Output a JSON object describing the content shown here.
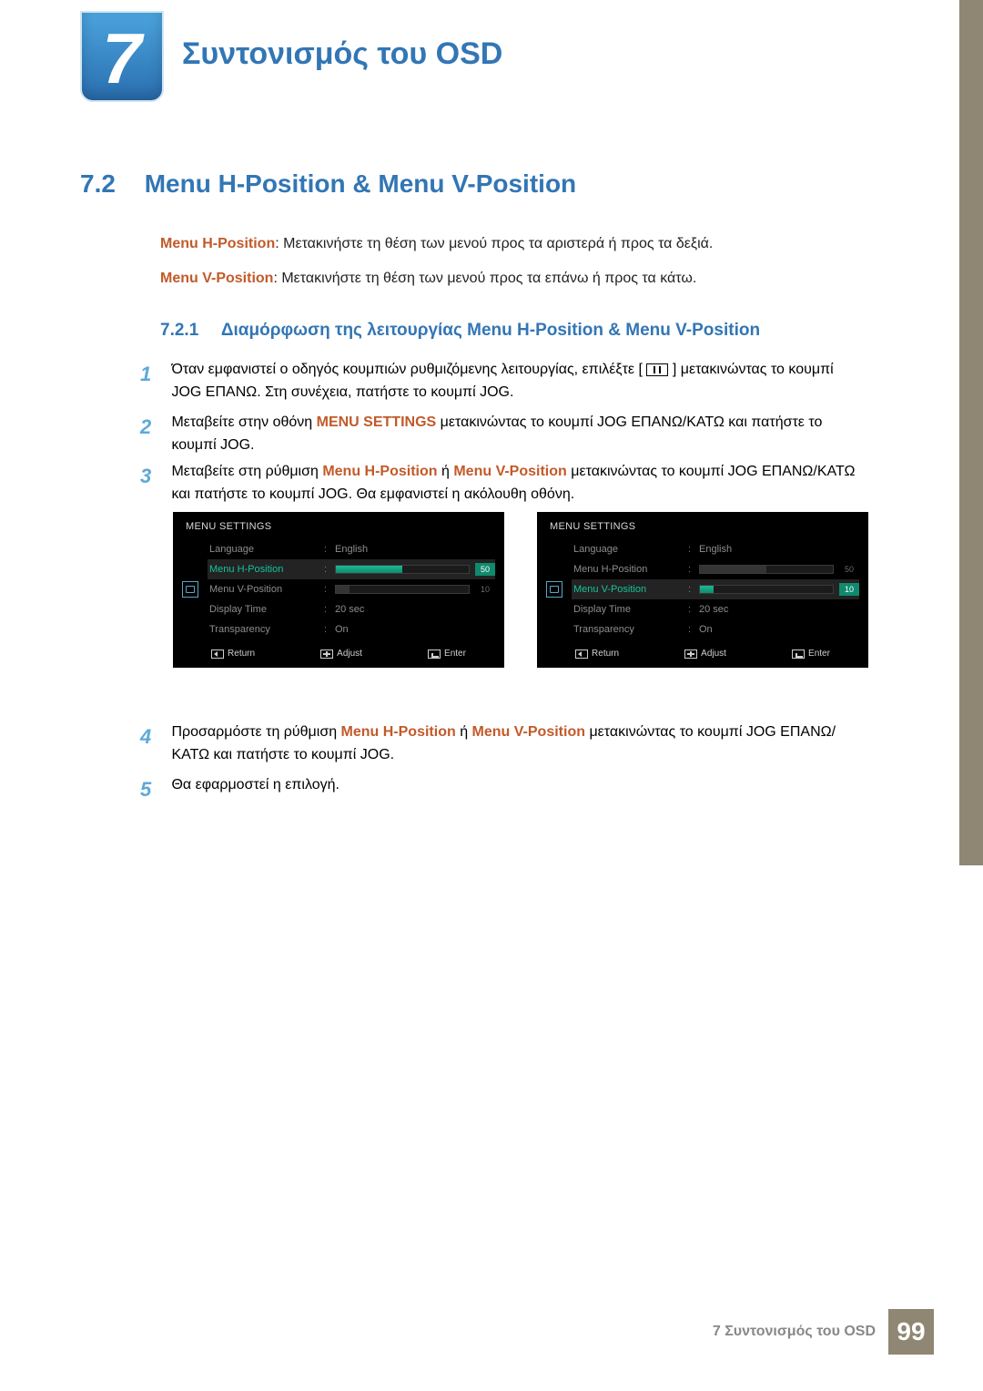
{
  "chapter": {
    "number": "7",
    "title": "Συντονισμός του OSD"
  },
  "section": {
    "number": "7.2",
    "title": "Menu H-Position & Menu V-Position"
  },
  "descriptions": {
    "h_label": "Menu H-Position",
    "h_text": ": Μετακινήστε τη θέση των μενού προς τα αριστερά ή προς τα δεξιά.",
    "v_label": "Menu V-Position",
    "v_text": ": Μετακινήστε τη θέση των μενού προς τα επάνω ή προς τα κάτω."
  },
  "subsection": {
    "number": "7.2.1",
    "title": "Διαμόρφωση της λειτουργίας Menu H-Position & Menu V-Position"
  },
  "steps": {
    "s1a": "Όταν εμφανιστεί ο οδηγός κουμπιών ρυθμιζόμενης λειτουργίας, επιλέξτε [",
    "s1b": "] μετακινώντας το κουμπί JOG ΕΠΑΝΩ. Στη συνέχεια, πατήστε το κουμπί JOG.",
    "s2a": "Μεταβείτε στην οθόνη ",
    "s2_bold": "MENU SETTINGS",
    "s2b": " μετακινώντας το κουμπί JOG ΕΠΑΝΩ/ΚΑΤΩ και πατήστε το κουμπί JOG.",
    "s3a": "Μεταβείτε στη ρύθμιση ",
    "s3_h": "Menu H-Position",
    "s3_or": " ή ",
    "s3_v": "Menu V-Position",
    "s3b": " μετακινώντας το κουμπί JOG ΕΠΑΝΩ/ΚΑΤΩ και πατήστε το κουμπί JOG. Θα εμφανιστεί η ακόλουθη οθόνη.",
    "s4a": "Προσαρμόστε τη ρύθμιση ",
    "s4_h": "Menu H-Position",
    "s4_or": " ή ",
    "s4_v": "Menu V-Position",
    "s4b": " μετακινώντας το κουμπί JOG ΕΠΑΝΩ/ΚΑΤΩ και πατήστε το κουμπί JOG.",
    "s5": "Θα εφαρμοστεί η επιλογή.",
    "n1": "1",
    "n2": "2",
    "n3": "3",
    "n4": "4",
    "n5": "5"
  },
  "osd": {
    "title": "MENU SETTINGS",
    "labels": {
      "language": "Language",
      "hpos": "Menu H-Position",
      "vpos": "Menu V-Position",
      "dtime": "Display Time",
      "trans": "Transparency"
    },
    "values": {
      "language": "English",
      "hpos": "50",
      "vpos": "10",
      "dtime": "20 sec",
      "trans": "On"
    },
    "footer": {
      "return": "Return",
      "adjust": "Adjust",
      "enter": "Enter"
    }
  },
  "footer": {
    "text": "7 Συντονισμός του OSD",
    "page": "99"
  }
}
